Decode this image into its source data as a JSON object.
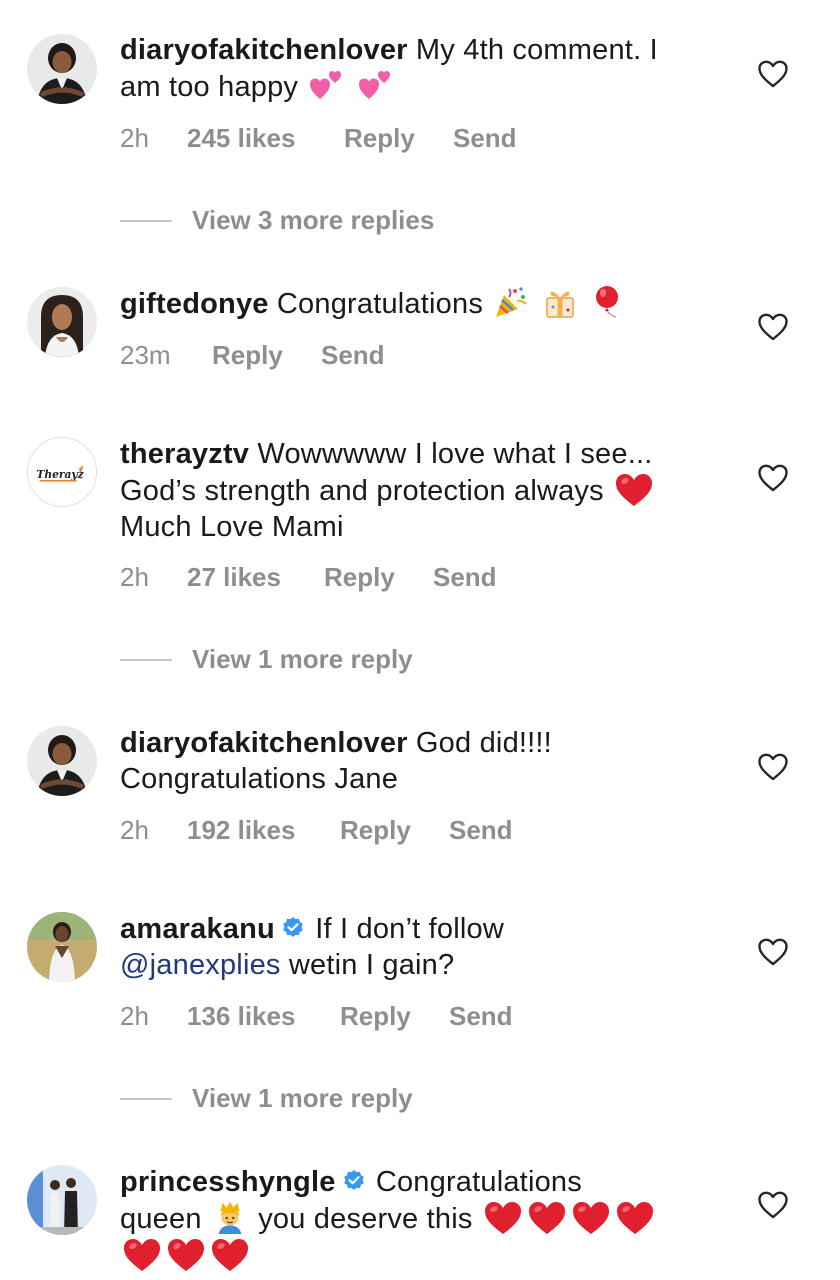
{
  "comments": [
    {
      "username": "diaryofakitchenlover",
      "text_1": "My 4th comment. I",
      "text_2": "am too happy",
      "time": "2h",
      "likes": "245 likes",
      "reply": "Reply",
      "send": "Send",
      "avatar_icon": "avatar-woman-chef",
      "emoji": [
        "two-hearts",
        "two-hearts"
      ]
    },
    {
      "username": "giftedonye",
      "text_1": "Congratulations",
      "time": "23m",
      "reply": "Reply",
      "send": "Send",
      "avatar_icon": "avatar-woman",
      "emoji": [
        "party-popper",
        "wrapped-gift",
        "balloon"
      ]
    },
    {
      "username": "therayztv",
      "text_1": "Wowwwww I love what I see...",
      "text_2": "God’s strength and protection always",
      "text_3": "Much Love Mami",
      "time": "2h",
      "likes": "27 likes",
      "reply": "Reply",
      "send": "Send",
      "avatar_icon": "therayz-logo",
      "avatar_logo_text": "Therayz",
      "emoji": [
        "red-heart"
      ]
    },
    {
      "username": "diaryofakitchenlover",
      "text_1": "God did!!!!",
      "text_2": "Congratulations Jane",
      "time": "2h",
      "likes": "192 likes",
      "reply": "Reply",
      "send": "Send",
      "avatar_icon": "avatar-woman-chef"
    },
    {
      "username": "amarakanu",
      "verified": true,
      "text_1": "If I don’t follow",
      "mention": "@janexplies",
      "text_2": "wetin I gain?",
      "time": "2h",
      "likes": "136 likes",
      "reply": "Reply",
      "send": "Send",
      "avatar_icon": "avatar-woman-outdoor"
    },
    {
      "username": "princesshyngle",
      "verified": true,
      "text_1": "Congratulations",
      "text_2a": "queen",
      "text_2b": "you deserve this",
      "avatar_icon": "avatar-couple",
      "emoji": [
        "crowned-person",
        "red-heart",
        "red-heart",
        "red-heart",
        "red-heart",
        "red-heart",
        "red-heart",
        "red-heart"
      ]
    }
  ],
  "view_replies": [
    {
      "label": "View 3 more replies"
    },
    {
      "label": "View 1 more reply"
    },
    {
      "label": "View 1 more reply"
    }
  ],
  "colors": {
    "text": "#1a1a1a",
    "meta": "#8e8e8e",
    "mention": "#1e3a7b",
    "verified": "#3897f0",
    "heart": "#e0202e",
    "pink_heart": "#f25fa8"
  }
}
